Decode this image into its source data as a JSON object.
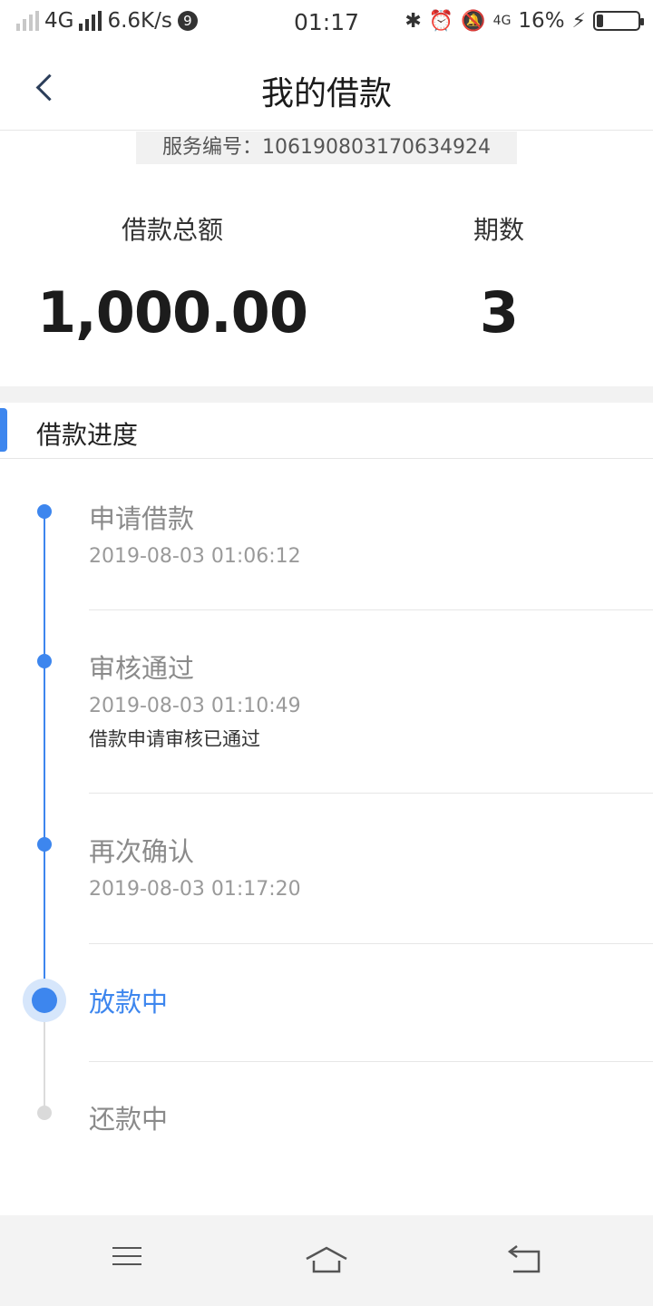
{
  "status_bar": {
    "network": "4G",
    "speed": "6.6K/s",
    "notification_count": "9",
    "time": "01:17",
    "network2": "4G",
    "battery": "16%",
    "battery_level": 0.16
  },
  "header": {
    "title": "我的借款"
  },
  "service": {
    "label": "服务编号：",
    "number": "106190803170634924"
  },
  "summary": {
    "amount_label": "借款总额",
    "amount_value": "1,000.00",
    "periods_label": "期数",
    "periods_value": "3"
  },
  "progress": {
    "title": "借款进度",
    "steps": [
      {
        "name": "申请借款",
        "time": "2019-08-03 01:06:12",
        "note": "",
        "state": "done"
      },
      {
        "name": "审核通过",
        "time": "2019-08-03 01:10:49",
        "note": "借款申请审核已通过",
        "state": "done"
      },
      {
        "name": "再次确认",
        "time": "2019-08-03 01:17:20",
        "note": "",
        "state": "done"
      },
      {
        "name": "放款中",
        "time": "",
        "note": "",
        "state": "active"
      },
      {
        "name": "还款中",
        "time": "",
        "note": "",
        "state": "pending"
      }
    ]
  },
  "nav": {
    "menu_icon": "menu-icon",
    "home_icon": "home-icon",
    "back_icon": "back-icon"
  },
  "colors": {
    "accent": "#3d86ee",
    "muted": "#8a8a8a",
    "band": "#f2f2f2"
  }
}
